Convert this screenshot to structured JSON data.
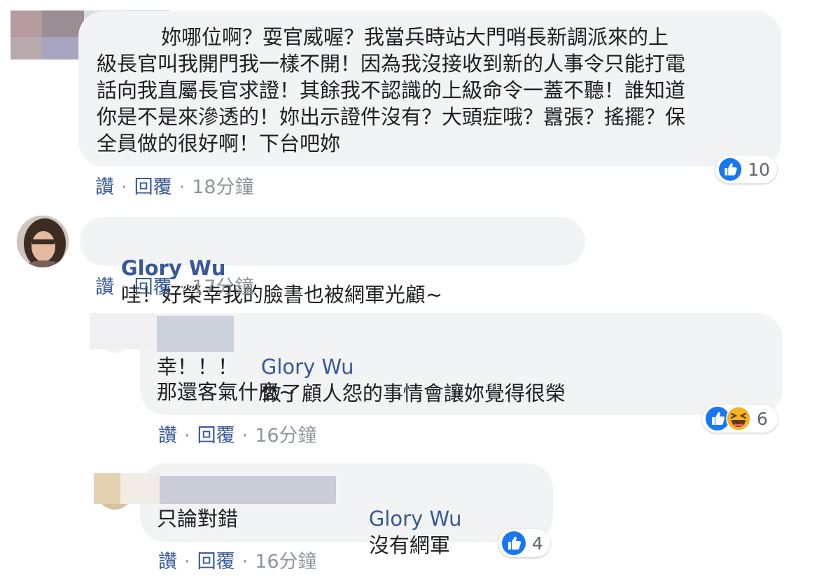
{
  "comments": [
    {
      "author": "",
      "lines": [
        "妳哪位啊？耍官威喔？我當兵時站大門哨長新調派來的上",
        "級長官叫我開門我一樣不開！因為我沒接收到新的人事令只能打電",
        "話向我直屬長官求證！其餘我不認識的上級命令一蓋不聽！誰知道",
        "你是不是來滲透的！妳出示證件沒有？大頭症哦？囂張？搖擺？保",
        "全員做的很好啊！下台吧妳"
      ],
      "actions": {
        "like": "讚",
        "reply": "回覆",
        "time": "18分鐘"
      },
      "reactions": {
        "types": [
          "like-icon"
        ],
        "count": "10"
      }
    },
    {
      "author": "Glory Wu",
      "text": "哇！好榮幸我的臉書也被網軍光顧~",
      "actions": {
        "like": "讚",
        "reply": "回覆",
        "time": "17分鐘"
      }
    },
    {
      "author": "",
      "tag": "Glory Wu",
      "lines": [
        "做了顧人怨的事情會讓妳覺得很榮",
        "幸！！！",
        "那還客氣什麼~"
      ],
      "actions": {
        "like": "讚",
        "reply": "回覆",
        "time": "16分鐘"
      },
      "reactions": {
        "types": [
          "like-icon",
          "haha-icon"
        ],
        "count": "6"
      }
    },
    {
      "author": "",
      "tag": "Glory Wu",
      "lines": [
        "沒有網軍",
        "只論對錯"
      ],
      "actions": {
        "like": "讚",
        "reply": "回覆",
        "time": "16分鐘"
      },
      "reactions": {
        "types": [
          "like-icon"
        ],
        "count": "4"
      }
    }
  ],
  "colors": {
    "link": "#385898",
    "bubble": "#f2f3f5",
    "meta": "#90949c",
    "like": "#1877f2",
    "haha": "#f7b125"
  }
}
